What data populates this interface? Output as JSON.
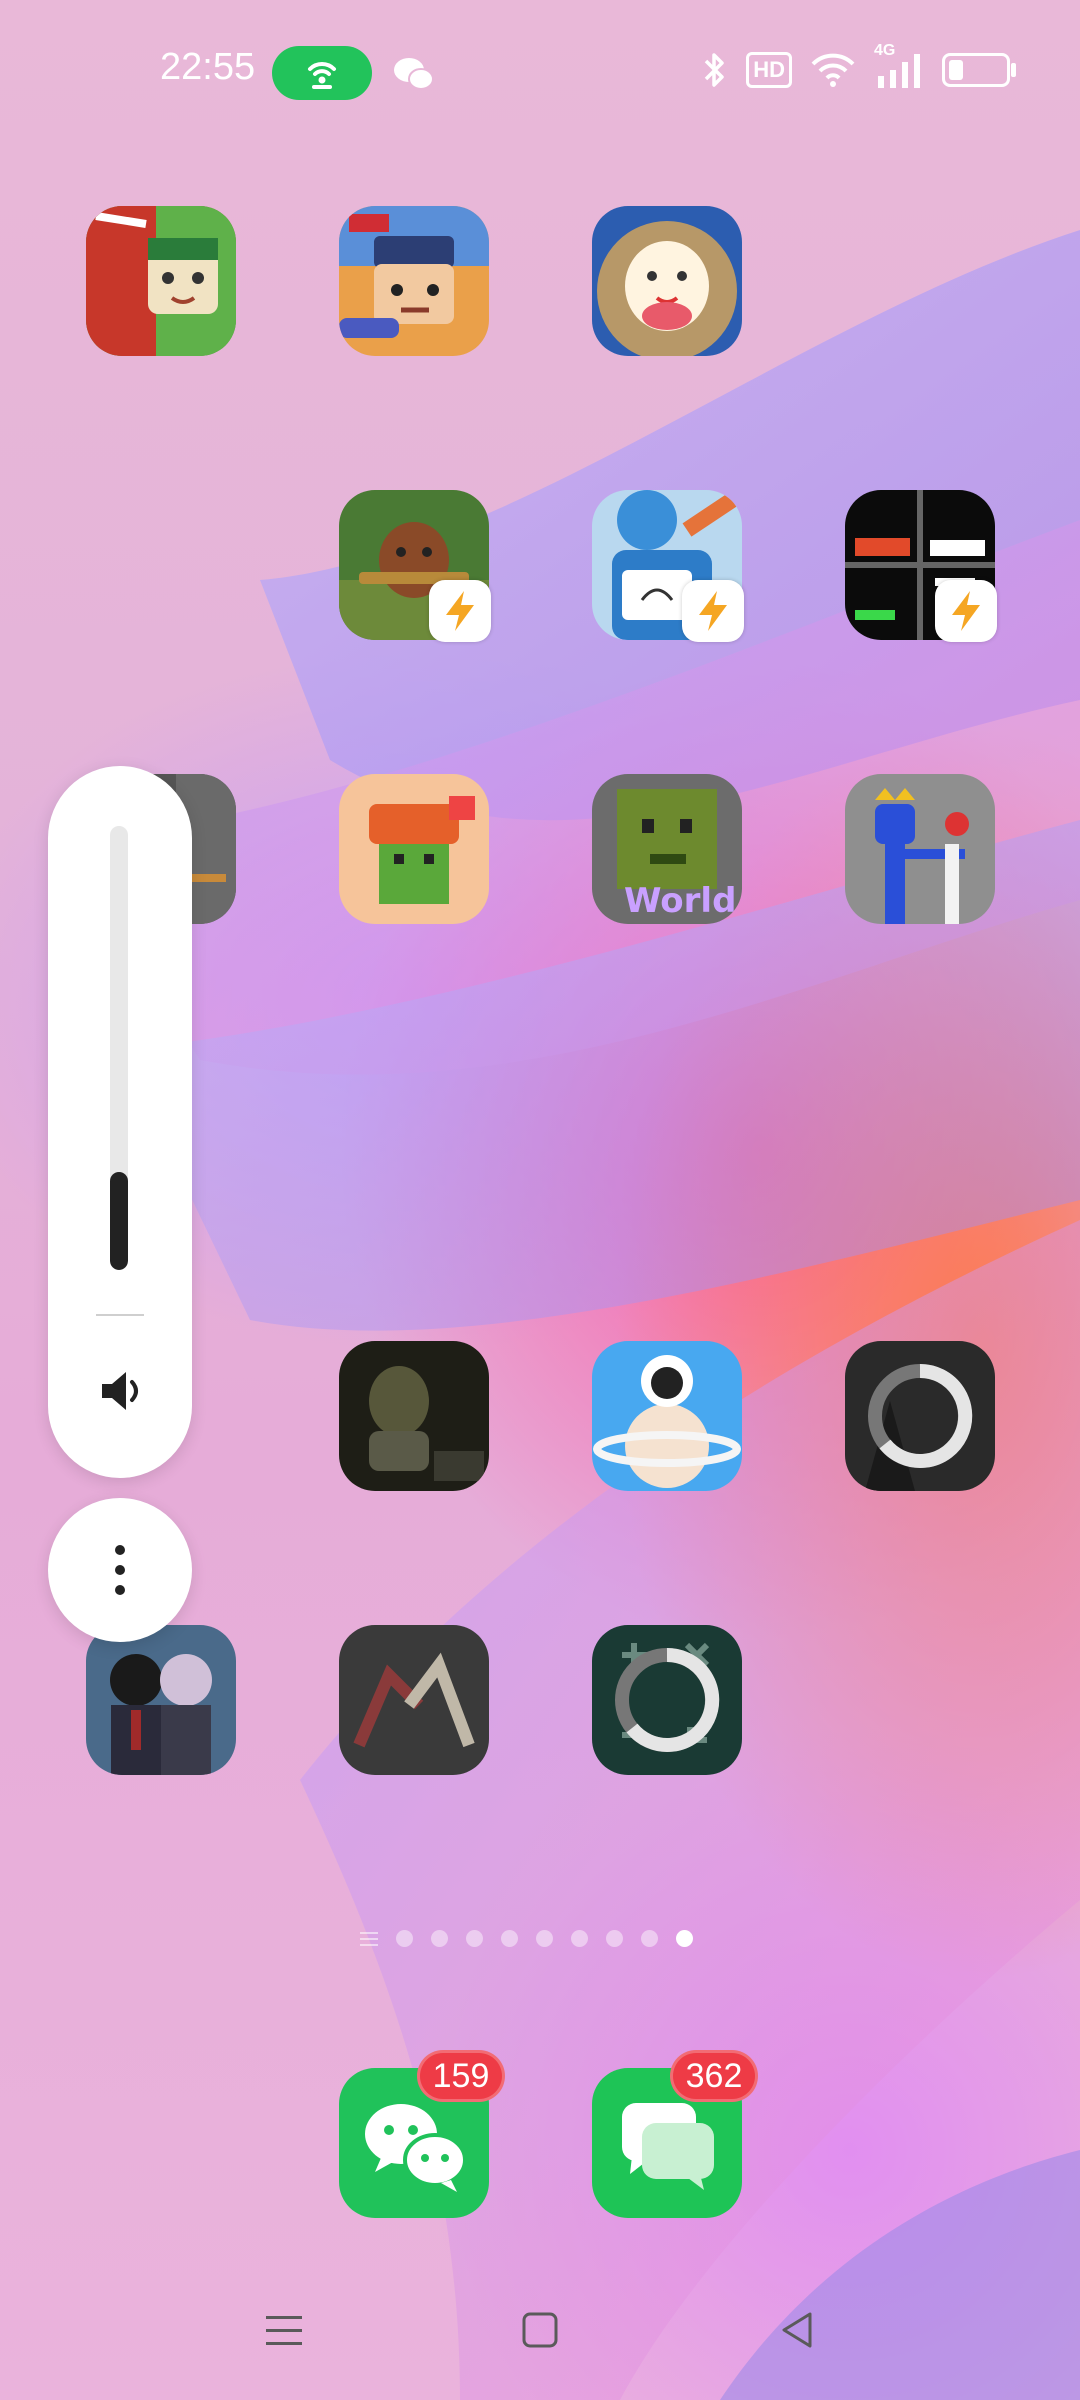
{
  "status_bar": {
    "time": "22:55",
    "icons": [
      "hotspot-icon",
      "wechat-icon",
      "bluetooth-icon",
      "hd-icon",
      "wifi-icon",
      "4g-signal-icon",
      "battery-icon"
    ],
    "hd_label": "HD",
    "network_label": "4G"
  },
  "home_grid": {
    "apps": [
      {
        "name": "mini-world-app",
        "row": 1,
        "col": 1
      },
      {
        "name": "mini-world-shooter-app",
        "row": 1,
        "col": 2
      },
      {
        "name": "egg-party-app",
        "row": 1,
        "col": 3
      },
      {
        "name": "bear-gun-game-app",
        "row": 2,
        "col": 2,
        "quick_app": true
      },
      {
        "name": "draw-cat-app",
        "row": 2,
        "col": 3,
        "quick_app": true
      },
      {
        "name": "pixel-game-app",
        "row": 2,
        "col": 4,
        "quick_app": true
      },
      {
        "name": "gray-game-app",
        "row": 3,
        "col": 1
      },
      {
        "name": "melon-playground-app",
        "row": 3,
        "col": 2
      },
      {
        "name": "melon-world-app",
        "row": 3,
        "col": 3
      },
      {
        "name": "blue-monster-app",
        "row": 3,
        "col": 4
      },
      {
        "name": "toilet-game-app",
        "row": 5,
        "col": 2
      },
      {
        "name": "astronaut-planet-app",
        "row": 5,
        "col": 3
      },
      {
        "name": "loading-app-1",
        "row": 5,
        "col": 4,
        "loading": true
      },
      {
        "name": "anime-school-app",
        "row": 6,
        "col": 1
      },
      {
        "name": "fight-game-app",
        "row": 6,
        "col": 2
      },
      {
        "name": "calculator-loading-app",
        "row": 6,
        "col": 3,
        "loading": true
      }
    ],
    "app_6_label": "World"
  },
  "volume_panel": {
    "level_percent": 22,
    "speaker_icon": "speaker-icon",
    "more_icon": "more-vertical-icon"
  },
  "page_indicator": {
    "pages": 9,
    "active_index": 9
  },
  "dock": [
    {
      "name": "wechat-app",
      "badge": "159",
      "color": "#20c25a"
    },
    {
      "name": "messages-app",
      "badge": "362",
      "color": "#1ec456"
    }
  ],
  "nav_bar": {
    "icons": [
      "menu-icon",
      "home-icon",
      "back-icon"
    ]
  }
}
